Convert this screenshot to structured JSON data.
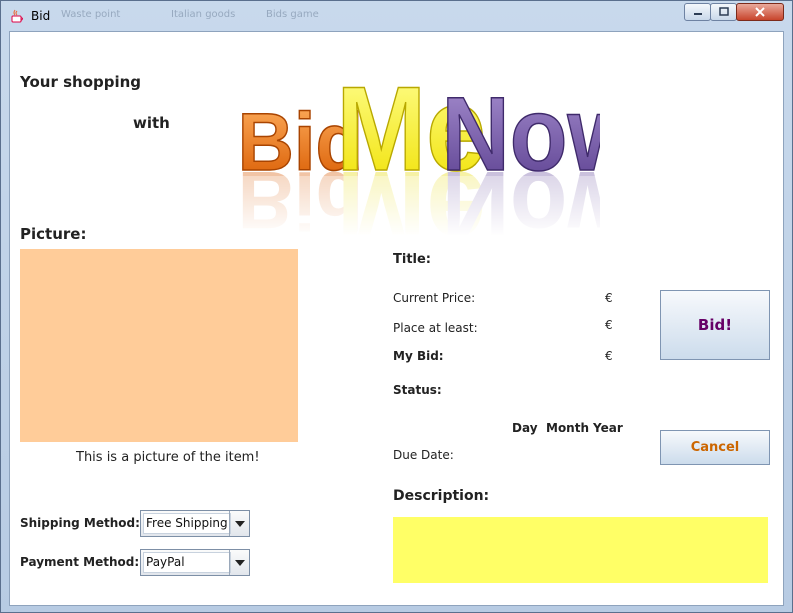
{
  "window": {
    "title": "Bid",
    "ghost_tabs": [
      "Waste point",
      "Italian goods",
      "Bids game"
    ]
  },
  "header": {
    "line1": "Your shopping",
    "line2": "with",
    "logo_text": [
      "Bid",
      "Me",
      "Now"
    ]
  },
  "picture": {
    "heading": "Picture:",
    "caption": "This is a picture of the item!",
    "color": "#ffcc99"
  },
  "shipping": {
    "label": "Shipping Method:",
    "value": "Free Shipping"
  },
  "payment": {
    "label": "Payment Method:",
    "value": "PayPal"
  },
  "item": {
    "title_label": "Title:",
    "current_price_label": "Current Price:",
    "place_at_least_label": "Place at least:",
    "my_bid_label": "My Bid:",
    "currency": "€",
    "status_label": "Status:",
    "date_cols": {
      "day": "Day",
      "month": "Month",
      "year": "Year"
    },
    "due_date_label": "Due Date:",
    "description_label": "Description:"
  },
  "buttons": {
    "bid": "Bid!",
    "cancel": "Cancel"
  },
  "colors": {
    "bid_text": "#660066",
    "cancel_text": "#cc6600",
    "description": "#ffff66"
  }
}
